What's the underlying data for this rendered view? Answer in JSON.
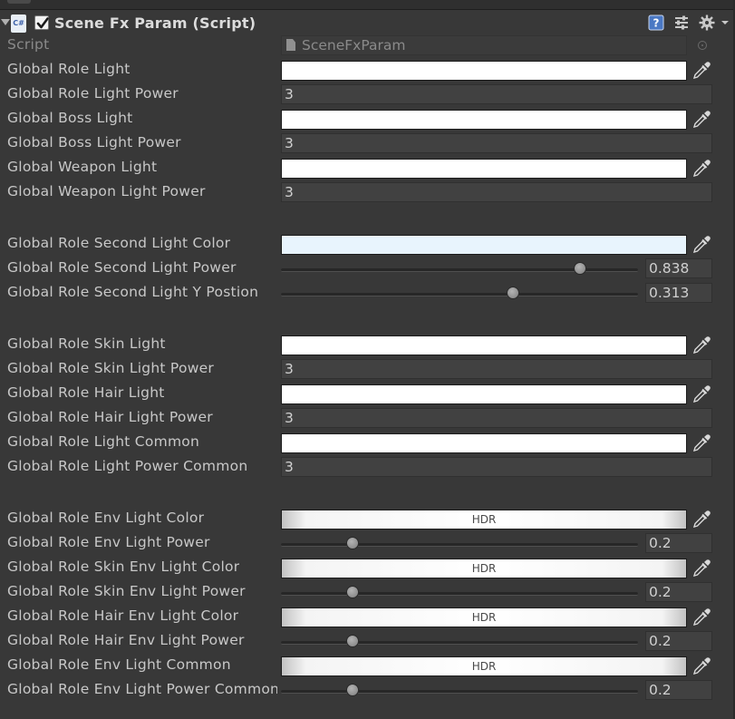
{
  "component": {
    "title": "Scene Fx Param (Script)",
    "script_icon_text": "C#",
    "enabled": true,
    "header_icons": [
      "help-icon",
      "presets-icon",
      "gear-icon"
    ]
  },
  "script_field": {
    "label": "Script",
    "value": "SceneFxParam"
  },
  "hdr_label": "HDR",
  "properties": [
    {
      "id": "global-role-light",
      "label": "Global Role Light",
      "type": "color",
      "color": "#FFFFFF"
    },
    {
      "id": "global-role-light-power",
      "label": "Global Role Light Power",
      "type": "number",
      "value": "3"
    },
    {
      "id": "global-boss-light",
      "label": "Global Boss Light",
      "type": "color",
      "color": "#FFFFFF"
    },
    {
      "id": "global-boss-light-power",
      "label": "Global Boss Light Power",
      "type": "number",
      "value": "3"
    },
    {
      "id": "global-weapon-light",
      "label": "Global Weapon Light",
      "type": "color",
      "color": "#FFFFFF"
    },
    {
      "id": "global-weapon-light-power",
      "label": "Global Weapon Light Power",
      "type": "number",
      "value": "3"
    },
    {
      "id": "global-role-second-light-color",
      "label": "Global Role Second Light Color",
      "type": "color",
      "color": "#E8F4FD"
    },
    {
      "id": "global-role-second-light-power",
      "label": "Global Role Second Light Power",
      "type": "slider",
      "value": "0.838",
      "fraction": 0.838
    },
    {
      "id": "global-role-second-light-y-postion",
      "label": "Global Role Second Light Y Postion",
      "type": "slider",
      "value": "0.313",
      "fraction": 0.65
    },
    {
      "id": "global-role-skin-light",
      "label": "Global Role Skin Light",
      "type": "color",
      "color": "#FFFFFF"
    },
    {
      "id": "global-role-skin-light-power",
      "label": "Global Role Skin Light Power",
      "type": "number",
      "value": "3"
    },
    {
      "id": "global-role-hair-light",
      "label": "Global Role Hair Light",
      "type": "color",
      "color": "#FFFFFF"
    },
    {
      "id": "global-role-hair-light-power",
      "label": "Global Role Hair Light Power",
      "type": "number",
      "value": "3"
    },
    {
      "id": "global-role-light-common",
      "label": "Global Role Light Common",
      "type": "color",
      "color": "#FFFFFF"
    },
    {
      "id": "global-role-light-power-common",
      "label": "Global Role Light Power Common",
      "type": "number",
      "value": "3"
    },
    {
      "id": "global-role-env-light-color",
      "label": "Global Role Env Light Color",
      "type": "hdr"
    },
    {
      "id": "global-role-env-light-power",
      "label": "Global Role Env Light Power",
      "type": "slider",
      "value": "0.2",
      "fraction": 0.2
    },
    {
      "id": "global-role-skin-env-light-color",
      "label": "Global Role Skin Env Light Color",
      "type": "hdr"
    },
    {
      "id": "global-role-skin-env-light-power",
      "label": "Global Role Skin Env Light Power",
      "type": "slider",
      "value": "0.2",
      "fraction": 0.2
    },
    {
      "id": "global-role-hair-env-light-color",
      "label": "Global Role Hair Env Light Color",
      "type": "hdr"
    },
    {
      "id": "global-role-hair-env-light-power",
      "label": "Global Role Hair Env Light Power",
      "type": "slider",
      "value": "0.2",
      "fraction": 0.2
    },
    {
      "id": "global-role-env-light-common",
      "label": "Global Role Env Light Common",
      "type": "hdr"
    },
    {
      "id": "global-role-env-light-power-common",
      "label": "Global Role Env Light Power Common",
      "type": "slider",
      "value": "0.2",
      "fraction": 0.2
    }
  ]
}
